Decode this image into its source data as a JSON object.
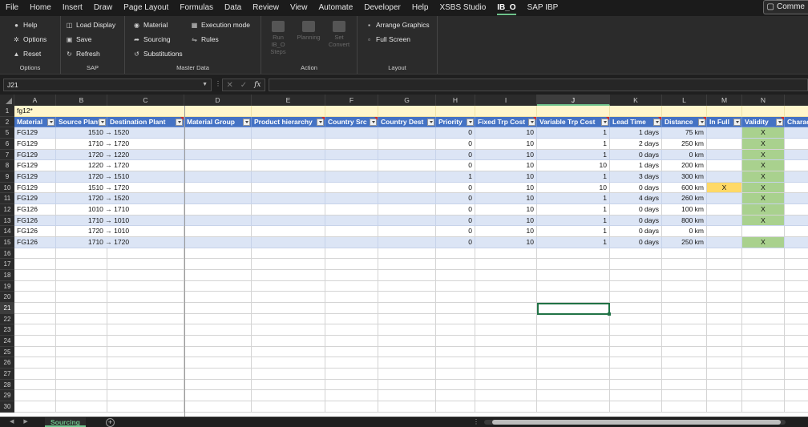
{
  "menu": {
    "tabs": [
      "File",
      "Home",
      "Insert",
      "Draw",
      "Page Layout",
      "Formulas",
      "Data",
      "Review",
      "View",
      "Automate",
      "Developer",
      "Help",
      "XSBS Studio",
      "IB_O",
      "SAP IBP"
    ],
    "active": "IB_O",
    "comments_label": "Comme"
  },
  "ribbon": {
    "options": {
      "label": "Options",
      "items": [
        "Help",
        "Options",
        "Reset"
      ]
    },
    "sap": {
      "label": "SAP",
      "items": [
        "Load Display",
        "Save",
        "Refresh"
      ]
    },
    "master_data": {
      "label": "Master Data",
      "items": [
        "Material",
        "Sourcing",
        "Substitutions",
        "Execution mode",
        "Rules"
      ]
    },
    "action": {
      "label": "Action",
      "run_label": "Run IB_O Steps",
      "planning_label": "Planning",
      "set_label": "Set Convert"
    },
    "layout": {
      "label": "Layout",
      "items": [
        "Arrange Graphics",
        "Full Screen"
      ]
    }
  },
  "formula_bar": {
    "name_box": "J21",
    "formula": ""
  },
  "sheet": {
    "columns": [
      "A",
      "B",
      "C",
      "D",
      "E",
      "F",
      "G",
      "H",
      "I",
      "J",
      "K",
      "L",
      "M",
      "N"
    ],
    "selected_column": "J",
    "selected_row": 21,
    "filter_cell": "fg12*",
    "headers": [
      "Material",
      "Source Plant",
      "Destination Plant",
      "Material Group",
      "Product hierarchy",
      "Country Src",
      "Country Dest",
      "Priority",
      "Fixed Trp Cost",
      "Variable Trp Cost",
      "Lead Time",
      "Distance",
      "In Full",
      "Validity",
      "Characte"
    ],
    "row_numbers": [
      1,
      2,
      5,
      6,
      7,
      8,
      9,
      10,
      11,
      12,
      13,
      14,
      15,
      16,
      17,
      18,
      19,
      20,
      21,
      22,
      23,
      24,
      25,
      26,
      27,
      28,
      29,
      30
    ],
    "rows": [
      {
        "material": "FG129",
        "route": "1510 → 1520",
        "priority": "0",
        "fixed": "10",
        "variable": "1",
        "lead": "1 days",
        "distance": "75 km",
        "infull": "",
        "validity": "X"
      },
      {
        "material": "FG129",
        "route": "1710 → 1720",
        "priority": "0",
        "fixed": "10",
        "variable": "1",
        "lead": "2 days",
        "distance": "250 km",
        "infull": "",
        "validity": "X"
      },
      {
        "material": "FG129",
        "route": "1720 → 1220",
        "priority": "0",
        "fixed": "10",
        "variable": "1",
        "lead": "0 days",
        "distance": "0 km",
        "infull": "",
        "validity": "X"
      },
      {
        "material": "FG129",
        "route": "1220 → 1720",
        "priority": "0",
        "fixed": "10",
        "variable": "10",
        "lead": "1 days",
        "distance": "200 km",
        "infull": "",
        "validity": "X"
      },
      {
        "material": "FG129",
        "route": "1720 → 1510",
        "priority": "1",
        "fixed": "10",
        "variable": "1",
        "lead": "3 days",
        "distance": "300 km",
        "infull": "",
        "validity": "X"
      },
      {
        "material": "FG129",
        "route": "1510 → 1720",
        "priority": "0",
        "fixed": "10",
        "variable": "10",
        "lead": "0 days",
        "distance": "600 km",
        "infull": "X",
        "validity": "X"
      },
      {
        "material": "FG129",
        "route": "1720 → 1520",
        "priority": "0",
        "fixed": "10",
        "variable": "1",
        "lead": "4 days",
        "distance": "260 km",
        "infull": "",
        "validity": "X"
      },
      {
        "material": "FG126",
        "route": "1010 → 1710",
        "priority": "0",
        "fixed": "10",
        "variable": "1",
        "lead": "0 days",
        "distance": "100 km",
        "infull": "",
        "validity": "X"
      },
      {
        "material": "FG126",
        "route": "1710 → 1010",
        "priority": "0",
        "fixed": "10",
        "variable": "1",
        "lead": "0 days",
        "distance": "800 km",
        "infull": "",
        "validity": "X"
      },
      {
        "material": "FG126",
        "route": "1720 → 1010",
        "priority": "0",
        "fixed": "10",
        "variable": "1",
        "lead": "0 days",
        "distance": "0 km",
        "infull": "",
        "validity": ""
      },
      {
        "material": "FG126",
        "route": "1710 → 1720",
        "priority": "0",
        "fixed": "10",
        "variable": "1",
        "lead": "0 days",
        "distance": "250 km",
        "infull": "",
        "validity": "X"
      }
    ]
  },
  "sheet_tabs": {
    "active": "Sourcing"
  },
  "colors": {
    "header_blue": "#4472c4",
    "alt_row": "#dce5f5",
    "validity_green": "#a9d18e",
    "infull_amber": "#ffd966",
    "accent": "#6ec28b"
  }
}
